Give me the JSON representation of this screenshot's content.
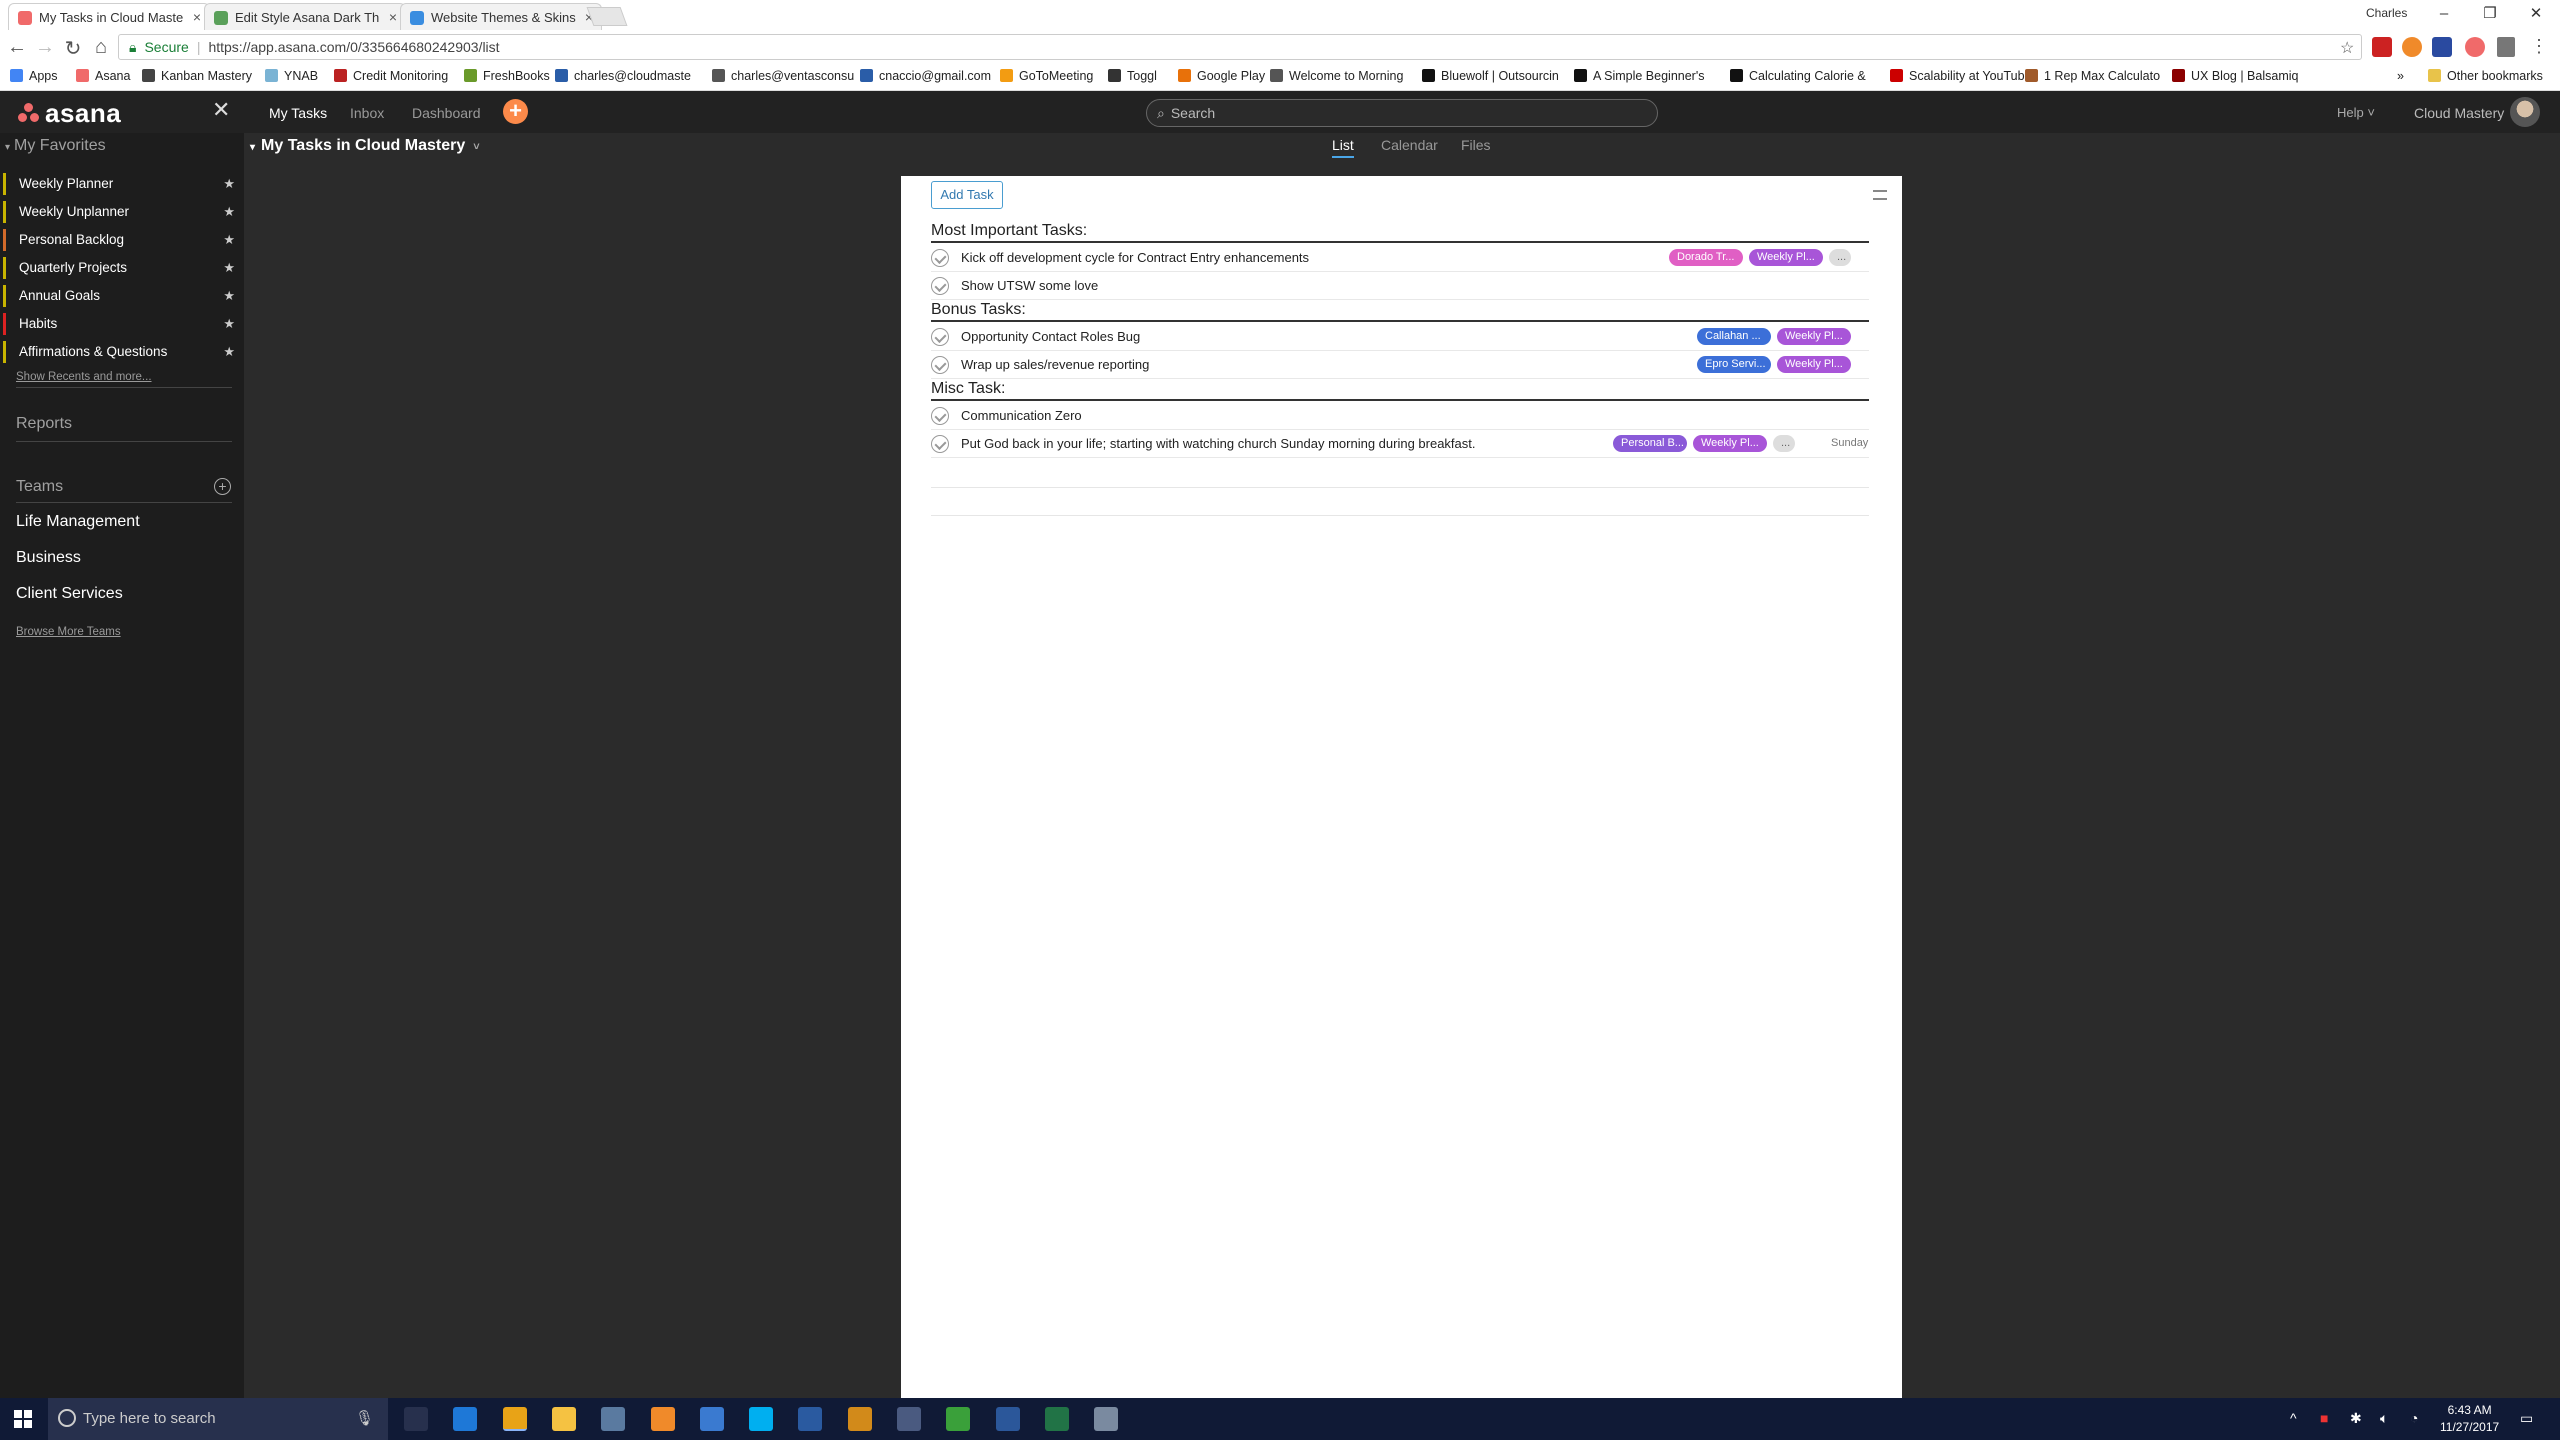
{
  "browser": {
    "tabs": [
      {
        "title": "My Tasks in Cloud Maste",
        "active": true,
        "favicon_color": "#f06a6a"
      },
      {
        "title": "Edit Style Asana Dark Th",
        "active": false,
        "favicon_color": "#5aa05a"
      },
      {
        "title": "Website Themes & Skins",
        "active": false,
        "favicon_color": "#3a8de0"
      }
    ],
    "user_badge": "Charles",
    "window_controls": {
      "minimize": "–",
      "restore": "❐",
      "close": "✕"
    },
    "secure_label": "Secure",
    "url": "https://app.asana.com/0/335664680242903/list",
    "bookmarks": [
      {
        "label": "Apps",
        "color": "#4285f4"
      },
      {
        "label": "Asana",
        "color": "#f06a6a"
      },
      {
        "label": "Kanban Mastery",
        "color": "#444"
      },
      {
        "label": "YNAB",
        "color": "#7ab3d4"
      },
      {
        "label": "Credit Monitoring",
        "color": "#b22"
      },
      {
        "label": "FreshBooks",
        "color": "#6a9a2a"
      },
      {
        "label": "charles@cloudmaste",
        "color": "#2a5da8"
      },
      {
        "label": "charles@ventasconsu",
        "color": "#555"
      },
      {
        "label": "cnaccio@gmail.com",
        "color": "#2a5da8"
      },
      {
        "label": "GoToMeeting",
        "color": "#f39c12"
      },
      {
        "label": "Toggl",
        "color": "#333"
      },
      {
        "label": "Google Play",
        "color": "#e8710a"
      },
      {
        "label": "Welcome to Morning",
        "color": "#555"
      },
      {
        "label": "Bluewolf | Outsourcin",
        "color": "#111"
      },
      {
        "label": "A Simple Beginner's",
        "color": "#111"
      },
      {
        "label": "Calculating Calorie &",
        "color": "#111"
      },
      {
        "label": "Scalability at YouTub",
        "color": "#cc0000"
      },
      {
        "label": "1 Rep Max Calculato",
        "color": "#a05a2a"
      },
      {
        "label": "UX Blog | Balsamiq",
        "color": "#8b0000"
      }
    ],
    "more_bookmarks": "»",
    "other_bookmarks": "Other bookmarks"
  },
  "app": {
    "logo": "asana",
    "logo_color": "#f06a6a",
    "nav_tabs": [
      "My Tasks",
      "Inbox",
      "Dashboard"
    ],
    "add_label": "+",
    "search_placeholder": "Search",
    "help_label": "Help ˅",
    "org_name": "Cloud Mastery"
  },
  "sidebar": {
    "favorites_title": "My Favorites",
    "favorites": [
      {
        "label": "Weekly Planner",
        "color": "#c8b400"
      },
      {
        "label": "Weekly Unplanner",
        "color": "#c8b400"
      },
      {
        "label": "Personal Backlog",
        "color": "#d26a2a"
      },
      {
        "label": "Quarterly Projects",
        "color": "#c8b400"
      },
      {
        "label": "Annual Goals",
        "color": "#c8b400"
      },
      {
        "label": "Habits",
        "color": "#d22"
      },
      {
        "label": "Affirmations & Questions",
        "color": "#c8b400"
      }
    ],
    "show_recents": "Show Recents and more...",
    "reports": "Reports",
    "teams_title": "Teams",
    "teams": [
      "Life Management",
      "Business",
      "Client Services"
    ],
    "browse_teams": "Browse More Teams"
  },
  "content": {
    "project_title": "My Tasks in Cloud Mastery",
    "view_tabs": [
      "List",
      "Calendar",
      "Files"
    ],
    "add_task": "Add Task",
    "sections": [
      {
        "title": "Most Important Tasks:",
        "tasks": [
          {
            "name": "Kick off development cycle for Contract Entry enhancements",
            "tags": [
              {
                "label": "Dorado Tr...",
                "color": "#e05fc4"
              },
              {
                "label": "Weekly Pl...",
                "color": "#a855d8"
              },
              {
                "label": "...",
                "color": "grey"
              }
            ],
            "due": ""
          },
          {
            "name": "Show UTSW some love",
            "tags": [],
            "due": ""
          }
        ]
      },
      {
        "title": "Bonus Tasks:",
        "tasks": [
          {
            "name": "Opportunity Contact Roles Bug",
            "tags": [
              {
                "label": "Callahan ...",
                "color": "#3c6fd8"
              },
              {
                "label": "Weekly Pl...",
                "color": "#a855d8"
              }
            ],
            "due": ""
          },
          {
            "name": "Wrap up sales/revenue reporting",
            "tags": [
              {
                "label": "Epro Servi...",
                "color": "#3c6fd8"
              },
              {
                "label": "Weekly Pl...",
                "color": "#a855d8"
              }
            ],
            "due": ""
          }
        ]
      },
      {
        "title": "Misc Task:",
        "tasks": [
          {
            "name": "Communication Zero",
            "tags": [],
            "due": ""
          },
          {
            "name": "Put God back in your life; starting with watching church Sunday morning during breakfast.",
            "tags": [
              {
                "label": "Personal B...",
                "color": "#8a5ad8"
              },
              {
                "label": "Weekly Pl...",
                "color": "#a855d8"
              },
              {
                "label": "...",
                "color": "grey"
              }
            ],
            "due": "Sunday"
          }
        ]
      }
    ]
  },
  "taskbar": {
    "search_placeholder": "Type here to search",
    "apps": [
      {
        "name": "task-view-icon",
        "color": "#27304d"
      },
      {
        "name": "edge-icon",
        "color": "#1e78d7"
      },
      {
        "name": "chrome-icon",
        "color": "#e8a317"
      },
      {
        "name": "file-explorer-icon",
        "color": "#f5c242"
      },
      {
        "name": "app-icon",
        "color": "#5a7aa0"
      },
      {
        "name": "app-icon",
        "color": "#f08a2a"
      },
      {
        "name": "app-icon",
        "color": "#3a7ad0"
      },
      {
        "name": "skype-icon",
        "color": "#00aff0"
      },
      {
        "name": "powershell-icon",
        "color": "#2a5aa0"
      },
      {
        "name": "sublime-icon",
        "color": "#d28a1a"
      },
      {
        "name": "calculator-icon",
        "color": "#4a5a80"
      },
      {
        "name": "app-icon",
        "color": "#3aa03a"
      },
      {
        "name": "word-icon",
        "color": "#2b579a"
      },
      {
        "name": "excel-icon",
        "color": "#217346"
      },
      {
        "name": "app-icon",
        "color": "#7a8aa0"
      }
    ],
    "time": "6:43 AM",
    "date": "11/27/2017"
  }
}
